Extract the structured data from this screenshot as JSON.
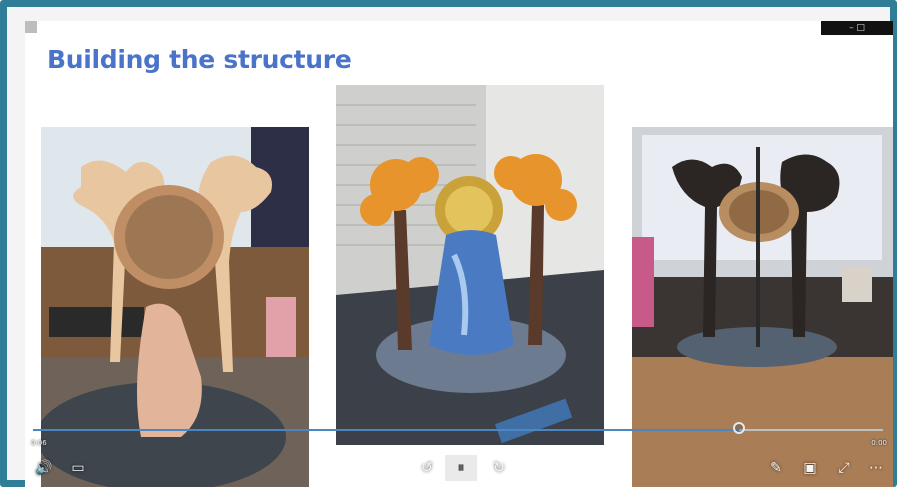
{
  "slide": {
    "title": "Building the structure",
    "accent_color": "#4a74c9",
    "border_color": "#2f7d96"
  },
  "window": {
    "topbar_controls": "– □"
  },
  "photos": [
    {
      "name": "wooden tree frame held with bowl"
    },
    {
      "name": "painted tree sculpture with blue waterfall on laser cutter"
    },
    {
      "name": "dark tree frame with bowl on desk"
    }
  ],
  "player": {
    "progress": 0.83,
    "time_left": "0:06",
    "time_right": "0:00",
    "controls": {
      "volume": "🔊",
      "captions": "▭",
      "rewind": "↺",
      "pause": "⏸",
      "forward": "↻",
      "pen": "✎",
      "pip": "▣",
      "fullscreen": "⤢",
      "more": "⋯"
    }
  }
}
